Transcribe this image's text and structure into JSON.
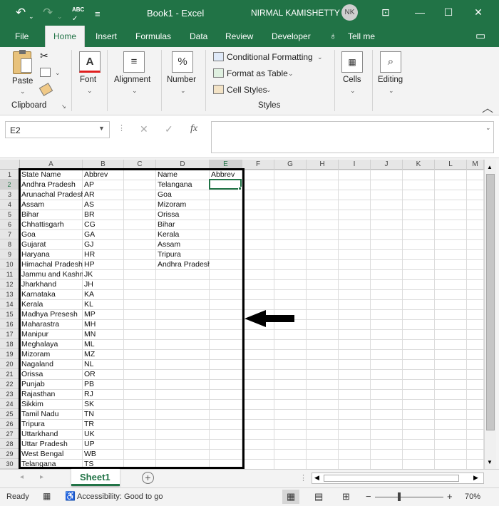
{
  "titlebar": {
    "undo_glyph": "↶",
    "redo_glyph": "↷",
    "spelling_label": "ABC",
    "customize_glyph": "≡",
    "title": "Book1 - Excel",
    "user": "NIRMAL KAMISHETTY",
    "avatar": "NK",
    "btn_display": "⊡",
    "btn_min": "—",
    "btn_max": "☐",
    "btn_close": "✕"
  },
  "tabs": [
    "File",
    "Home",
    "Insert",
    "Formulas",
    "Data",
    "Review",
    "Developer",
    "Tell me"
  ],
  "ribbon": {
    "paste": "Paste",
    "clipboard": "Clipboard",
    "font": "Font",
    "font_icon": "A",
    "alignment": "Alignment",
    "alignment_icon": "≡",
    "number": "Number",
    "number_icon": "%",
    "conditional_formatting": "Conditional Formatting",
    "format_as_table": "Format as Table",
    "cell_styles": "Cell Styles",
    "styles": "Styles",
    "cells": "Cells",
    "editing": "Editing",
    "editing_icon": "⌕"
  },
  "formula_bar": {
    "name_box": "E2",
    "fx": "fx",
    "cancel": "✕",
    "enter": "✓"
  },
  "columns": [
    "A",
    "B",
    "C",
    "D",
    "E",
    "F",
    "G",
    "H",
    "I",
    "J",
    "K",
    "L",
    "M"
  ],
  "rows": [
    "1",
    "2",
    "3",
    "4",
    "5",
    "6",
    "7",
    "8",
    "9",
    "10",
    "11",
    "12",
    "13",
    "14",
    "15",
    "16",
    "17",
    "18",
    "19",
    "20",
    "21",
    "22",
    "23",
    "24",
    "25",
    "26",
    "27",
    "28",
    "29",
    "30"
  ],
  "sheet": {
    "A": [
      "State Name",
      "Andhra Pradesh",
      "Arunachal Pradesh",
      "Assam",
      "Bihar",
      "Chhattisgarh",
      "Goa",
      "Gujarat",
      "Haryana",
      "Himachal Pradesh",
      "Jammu and Kashmir",
      "Jharkhand",
      "Karnataka",
      "Kerala",
      "Madhya Presesh",
      "Maharastra",
      "Manipur",
      "Meghalaya",
      "Mizoram",
      "Nagaland",
      "Orissa",
      "Punjab",
      "Rajasthan",
      "Sikkim",
      "Tamil Nadu",
      "Tripura",
      "Uttarkhand",
      "Uttar Pradesh",
      "West Bengal",
      "Telangana"
    ],
    "B": [
      "Abbrev",
      "AP",
      "AR",
      "AS",
      "BR",
      "CG",
      "GA",
      "GJ",
      "HR",
      "HP",
      "JK",
      "JH",
      "KA",
      "KL",
      "MP",
      "MH",
      "MN",
      "ML",
      "MZ",
      "NL",
      "OR",
      "PB",
      "RJ",
      "SK",
      "TN",
      "TR",
      "UK",
      "UP",
      "WB",
      "TS"
    ],
    "D": [
      "Name",
      "Telangana",
      "Goa",
      "Mizoram",
      "Orissa",
      "Bihar",
      "Kerala",
      "Assam",
      "Tripura",
      "Andhra Pradesh"
    ],
    "E": [
      "Abbrev"
    ]
  },
  "sheet_tab": "Sheet1",
  "status": {
    "ready": "Ready",
    "accessibility": "Accessibility: Good to go",
    "zoom": "70%"
  }
}
